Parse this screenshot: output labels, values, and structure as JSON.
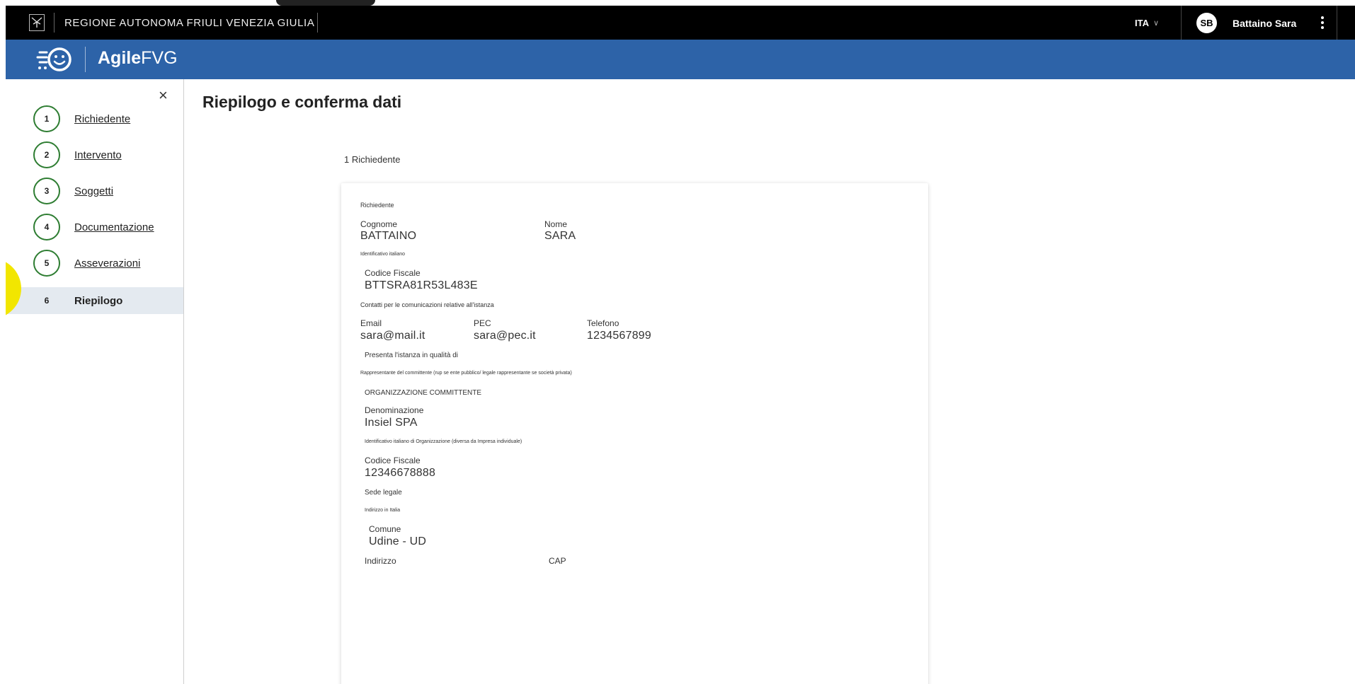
{
  "topbar": {
    "region_name": "REGIONE AUTONOMA FRIULI VENEZIA GIULIA",
    "language": "ITA",
    "user_initials": "SB",
    "user_name": "Battaino Sara"
  },
  "appbar": {
    "logo_bold": "Agile",
    "logo_rest": "FVG"
  },
  "sidebar": {
    "close_label": "×",
    "steps": [
      {
        "number": "1",
        "label": "Richiedente"
      },
      {
        "number": "2",
        "label": "Intervento"
      },
      {
        "number": "3",
        "label": "Soggetti"
      },
      {
        "number": "4",
        "label": "Documentazione"
      },
      {
        "number": "5",
        "label": "Asseverazioni"
      },
      {
        "number": "6",
        "label": "Riepilogo"
      }
    ]
  },
  "main": {
    "page_title": "Riepilogo e conferma dati",
    "section_title": "1 Richiedente"
  },
  "card": {
    "heading": "Richiedente",
    "cognome_label": "Cognome",
    "cognome_value": "BATTAINO",
    "nome_label": "Nome",
    "nome_value": "SARA",
    "identificativo_label": "Identificativo italiano",
    "cf_label": "Codice Fiscale",
    "cf_value": "BTTSRA81R53L483E",
    "contatti_label": "Contatti per le comunicazioni relative all'istanza",
    "email_label": "Email",
    "email_value": "sara@mail.it",
    "pec_label": "PEC",
    "pec_value": "sara@pec.it",
    "telefono_label": "Telefono",
    "telefono_value": "1234567899",
    "qualita_label": "Presenta l'istanza in qualità di",
    "qualita_value": "Rappresentante del committente (rup se ente pubblico/ legale rappresentante se società privata)",
    "org_heading": "ORGANIZZAZIONE COMMITTENTE",
    "denominazione_label": "Denominazione",
    "denominazione_value": "Insiel SPA",
    "org_identificativo_label": "Identificativo italiano di Organizzazione (diversa da Impresa individuale)",
    "org_cf_label": "Codice Fiscale",
    "org_cf_value": "12346678888",
    "sede_label": "Sede legale",
    "indirizzo_italia_label": "Indirizzo in Italia",
    "comune_label": "Comune",
    "comune_value": "Udine - UD",
    "indirizzo_label": "Indirizzo",
    "cap_label": "CAP"
  }
}
